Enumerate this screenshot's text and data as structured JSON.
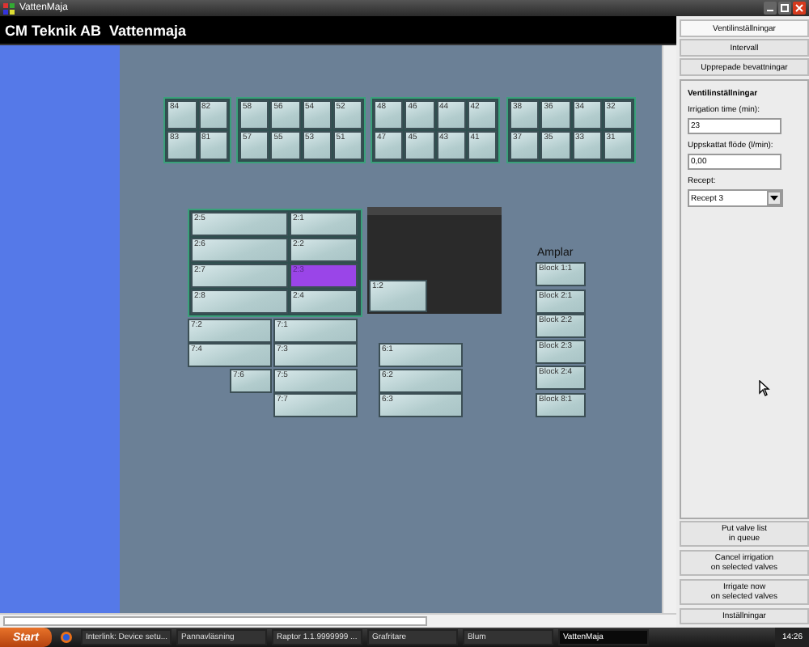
{
  "window": {
    "title": "VattenMaja"
  },
  "header": {
    "title": "CM Teknik AB  Vattenmaja"
  },
  "top_groups": [
    {
      "valves": [
        {
          "label": "84",
          "selected": false
        },
        {
          "label": "82",
          "selected": false
        },
        {
          "label": "83",
          "selected": false
        },
        {
          "label": "81",
          "selected": false
        }
      ]
    },
    {
      "valves": [
        {
          "label": "58",
          "selected": false
        },
        {
          "label": "56",
          "selected": false
        },
        {
          "label": "54",
          "selected": false
        },
        {
          "label": "52",
          "selected": false
        },
        {
          "label": "57",
          "selected": false
        },
        {
          "label": "55",
          "selected": false
        },
        {
          "label": "53",
          "selected": false
        },
        {
          "label": "51",
          "selected": false
        }
      ]
    },
    {
      "valves": [
        {
          "label": "48",
          "selected": false
        },
        {
          "label": "46",
          "selected": false
        },
        {
          "label": "44",
          "selected": false
        },
        {
          "label": "42",
          "selected": false
        },
        {
          "label": "47",
          "selected": false
        },
        {
          "label": "45",
          "selected": false
        },
        {
          "label": "43",
          "selected": false
        },
        {
          "label": "41",
          "selected": false
        }
      ]
    },
    {
      "valves": [
        {
          "label": "38",
          "selected": false
        },
        {
          "label": "36",
          "selected": false
        },
        {
          "label": "34",
          "selected": false
        },
        {
          "label": "32",
          "selected": false
        },
        {
          "label": "37",
          "selected": false
        },
        {
          "label": "35",
          "selected": false
        },
        {
          "label": "33",
          "selected": false
        },
        {
          "label": "31",
          "selected": false
        }
      ]
    }
  ],
  "block_2": [
    {
      "label": "2:5",
      "selected": false
    },
    {
      "label": "2:1",
      "selected": false
    },
    {
      "label": "2:6",
      "selected": false
    },
    {
      "label": "2:2",
      "selected": false
    },
    {
      "label": "2:7",
      "selected": false
    },
    {
      "label": "2:3",
      "selected": true
    },
    {
      "label": "2:8",
      "selected": false
    },
    {
      "label": "2:4",
      "selected": false
    }
  ],
  "block_1": [
    {
      "label": "1:2",
      "selected": false
    }
  ],
  "block_7": [
    {
      "label": "7:2",
      "selected": false
    },
    {
      "label": "7:1",
      "selected": false
    },
    {
      "label": "7:4",
      "selected": false
    },
    {
      "label": "7:3",
      "selected": false
    },
    {
      "label": "7:6",
      "selected": false
    },
    {
      "label": "7:5",
      "selected": false
    },
    {
      "label": "7:7",
      "selected": false
    }
  ],
  "block_6": [
    {
      "label": "6:1",
      "selected": false
    },
    {
      "label": "6:2",
      "selected": false
    },
    {
      "label": "6:3",
      "selected": false
    }
  ],
  "lamps": {
    "title": "Amplar",
    "items": [
      {
        "label": "Block 1:1",
        "selected": false
      },
      {
        "label": "Block 2:1",
        "selected": false
      },
      {
        "label": "Block 2:2",
        "selected": false
      },
      {
        "label": "Block 2:3",
        "selected": false
      },
      {
        "label": "Block 2:4",
        "selected": false
      },
      {
        "label": "Block 8:1",
        "selected": false
      }
    ]
  },
  "side_tabs": [
    {
      "label": "Ventilinställningar",
      "selected": true
    },
    {
      "label": "Intervall",
      "selected": false
    },
    {
      "label": "Upprepade bevattningar",
      "selected": false
    }
  ],
  "settings": {
    "title": "Ventilinställningar",
    "fields": [
      {
        "kind": "text",
        "label": "Irrigation time (min):",
        "value": "23"
      },
      {
        "kind": "text",
        "label": "Uppskattat flöde (l/min):",
        "value": "0,00"
      },
      {
        "kind": "select",
        "label": "Recept:",
        "value": "Recept 3"
      }
    ]
  },
  "actions": [
    {
      "lines": [
        "Put valve list",
        "in queue"
      ]
    },
    {
      "lines": [
        "Cancel irrigation",
        "on selected valves"
      ]
    },
    {
      "lines": [
        "Irrigate now",
        "on selected valves"
      ]
    },
    {
      "lines": [
        "Inställningar"
      ]
    }
  ],
  "taskbar": {
    "start": "Start",
    "items": [
      {
        "label": "Interlink: Device setu...",
        "selected": false
      },
      {
        "label": "Pannavläsning",
        "selected": false
      },
      {
        "label": "Raptor 1.1.9999999 ...",
        "selected": false
      },
      {
        "label": "Grafritare",
        "selected": false
      },
      {
        "label": "Blum",
        "selected": false
      },
      {
        "label": "VattenMaja",
        "selected": true
      }
    ],
    "clock": "14:26"
  }
}
